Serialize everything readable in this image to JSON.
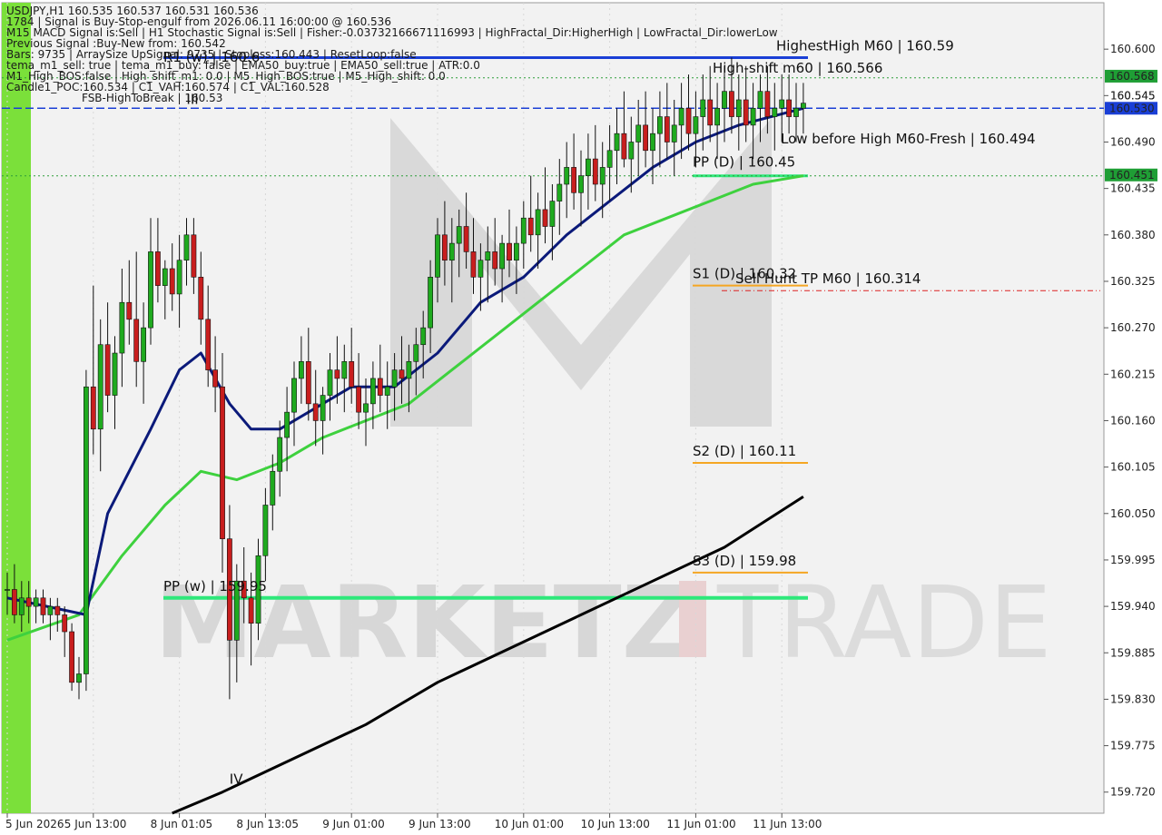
{
  "info": {
    "lines": [
      "USDJPY,H1  160.535 160.537 160.531 160.536",
      "1784 | Signal is Buy-Stop-engulf from 2026.06.11 16:00:00 @ 160.536",
      "M15 MACD Signal is:Sell | H1 Stochastic Signal is:Sell | Fisher:-0.03732166671116993 | HighFractal_Dir:HigherHigh | LowFractal_Dir:lowerLow",
      "Previous Signal :Buy-New from: 160.542",
      "Bars: 9735 | ArraySize UpSignal: 9735 | Stoploss:160.443 | ResetLoop:false",
      "tema_m1_sell: true | tema_m1_buy: false | EMA50_buy:true | EMA50_sell:true | ATR:0.0",
      "M1_High_BOS:false | High_shift_m1: 0.0 | M5_High_BOS:true | M5_High_shift: 0.0",
      "Candle1_POC:160.534 | C1_VAH:160.574 | C1_VAL:160.528",
      "FSB-HighToBreak | 160.53"
    ]
  },
  "colors": {
    "bull": "#1faa1f",
    "bear": "#c81e1e",
    "ema_fast": "#0b1a7a",
    "ema_mid": "#3ed13e",
    "ema_slow": "#000000",
    "pp_line": "#2ee87a",
    "support": "#f5a623",
    "current": "#1a3fd6",
    "tag_green": "#1f9e35",
    "sideband": "#7be03a"
  },
  "chart_data": {
    "type": "candlestick",
    "symbol": "USDJPY",
    "timeframe": "H1",
    "y_axis": {
      "min": 159.695,
      "max": 160.655,
      "ticks": [
        "160.600",
        "160.545",
        "160.490",
        "160.435",
        "160.380",
        "160.325",
        "160.270",
        "160.215",
        "160.160",
        "160.105",
        "160.050",
        "159.995",
        "159.940",
        "159.885",
        "159.830",
        "159.775",
        "159.720"
      ]
    },
    "x_axis": {
      "labels": [
        "5 Jun 2026",
        "5 Jun 13:00",
        "8 Jun 01:05",
        "8 Jun 13:05",
        "9 Jun 01:00",
        "9 Jun 13:00",
        "10 Jun 01:00",
        "10 Jun 13:00",
        "11 Jun 01:00",
        "11 Jun 13:00"
      ],
      "label_bar_index": [
        0,
        12,
        24,
        36,
        48,
        60,
        72,
        84,
        96,
        108
      ]
    },
    "price_tags": [
      {
        "value": 160.568,
        "label": "160.568",
        "kind": "green"
      },
      {
        "value": 160.545,
        "label": "160.545",
        "kind": "plain"
      },
      {
        "value": 160.53,
        "label": "160.530",
        "kind": "blue"
      },
      {
        "value": 160.451,
        "label": "160.451",
        "kind": "green"
      }
    ],
    "levels": [
      {
        "label": "HighestHigh   M60 | 160.59",
        "value": 160.59,
        "kind": "blue"
      },
      {
        "label": "High-shift m60 | 160.566",
        "value": 160.566,
        "kind": "dotted_green"
      },
      {
        "label": "Low before High   M60-Fresh | 160.494",
        "value": 160.494,
        "kind": "none"
      },
      {
        "label": "PP (D) | 160.45",
        "value": 160.45,
        "kind": "pp_short"
      },
      {
        "label": "S1 (D) | 160.32",
        "value": 160.32,
        "kind": "support"
      },
      {
        "label": "Sell Hunt TP M60 | 160.314",
        "value": 160.314,
        "kind": "red_dash"
      },
      {
        "label": "S2 (D) | 160.11",
        "value": 160.11,
        "kind": "support"
      },
      {
        "label": "S3 (D) | 159.98",
        "value": 159.98,
        "kind": "support"
      },
      {
        "label": "PP (w) | 159.95",
        "value": 159.95,
        "kind": "pp_long"
      },
      {
        "label": "R1 (w) | 160.6",
        "value": 160.6,
        "kind": "r1w"
      }
    ],
    "wave_labels": [
      {
        "label": "III",
        "bar": 26,
        "value": 160.535
      },
      {
        "label": "IV",
        "bar": 32,
        "value": 159.73
      }
    ],
    "candles": [
      [
        159.96,
        159.98,
        159.93,
        159.96
      ],
      [
        159.96,
        159.99,
        159.92,
        159.93
      ],
      [
        159.93,
        159.97,
        159.91,
        159.95
      ],
      [
        159.95,
        159.97,
        159.92,
        159.94
      ],
      [
        159.94,
        159.96,
        159.92,
        159.95
      ],
      [
        159.95,
        159.96,
        159.92,
        159.93
      ],
      [
        159.93,
        159.95,
        159.9,
        159.94
      ],
      [
        159.94,
        159.95,
        159.91,
        159.93
      ],
      [
        159.93,
        159.94,
        159.88,
        159.91
      ],
      [
        159.91,
        159.92,
        159.84,
        159.85
      ],
      [
        159.85,
        159.88,
        159.83,
        159.86
      ],
      [
        159.86,
        160.22,
        159.84,
        160.2
      ],
      [
        160.2,
        160.32,
        160.12,
        160.15
      ],
      [
        160.15,
        160.28,
        160.1,
        160.25
      ],
      [
        160.25,
        160.3,
        160.17,
        160.19
      ],
      [
        160.19,
        160.26,
        160.15,
        160.24
      ],
      [
        160.24,
        160.34,
        160.2,
        160.3
      ],
      [
        160.3,
        160.35,
        160.25,
        160.28
      ],
      [
        160.28,
        160.36,
        160.2,
        160.23
      ],
      [
        160.23,
        160.3,
        160.18,
        160.27
      ],
      [
        160.27,
        160.4,
        160.25,
        160.36
      ],
      [
        160.36,
        160.4,
        160.3,
        160.32
      ],
      [
        160.32,
        160.35,
        160.28,
        160.34
      ],
      [
        160.34,
        160.37,
        160.29,
        160.31
      ],
      [
        160.31,
        160.38,
        160.27,
        160.35
      ],
      [
        160.35,
        160.4,
        160.32,
        160.38
      ],
      [
        160.38,
        160.4,
        160.31,
        160.33
      ],
      [
        160.33,
        160.36,
        160.25,
        160.28
      ],
      [
        160.28,
        160.32,
        160.2,
        160.22
      ],
      [
        160.22,
        160.26,
        160.17,
        160.2
      ],
      [
        160.2,
        160.24,
        159.98,
        160.02
      ],
      [
        160.02,
        160.06,
        159.83,
        159.9
      ],
      [
        159.9,
        159.99,
        159.85,
        159.97
      ],
      [
        159.97,
        160.01,
        159.92,
        159.95
      ],
      [
        159.95,
        159.98,
        159.87,
        159.92
      ],
      [
        159.92,
        160.02,
        159.9,
        160.0
      ],
      [
        160.0,
        160.08,
        159.97,
        160.06
      ],
      [
        160.06,
        160.12,
        160.03,
        160.1
      ],
      [
        160.1,
        160.16,
        160.07,
        160.14
      ],
      [
        160.14,
        160.2,
        160.1,
        160.17
      ],
      [
        160.17,
        160.23,
        160.13,
        160.21
      ],
      [
        160.21,
        160.26,
        160.18,
        160.23
      ],
      [
        160.23,
        160.27,
        160.16,
        160.18
      ],
      [
        160.18,
        160.22,
        160.13,
        160.16
      ],
      [
        160.16,
        160.2,
        160.12,
        160.19
      ],
      [
        160.19,
        160.24,
        160.16,
        160.22
      ],
      [
        160.22,
        160.26,
        160.18,
        160.21
      ],
      [
        160.21,
        160.25,
        160.17,
        160.23
      ],
      [
        160.23,
        160.27,
        160.18,
        160.2
      ],
      [
        160.2,
        160.24,
        160.15,
        160.17
      ],
      [
        160.17,
        160.21,
        160.13,
        160.18
      ],
      [
        160.18,
        160.23,
        160.15,
        160.21
      ],
      [
        160.21,
        160.25,
        160.17,
        160.19
      ],
      [
        160.19,
        160.23,
        160.15,
        160.2
      ],
      [
        160.2,
        160.24,
        160.16,
        160.22
      ],
      [
        160.22,
        160.26,
        160.18,
        160.21
      ],
      [
        160.21,
        160.25,
        160.17,
        160.23
      ],
      [
        160.23,
        160.27,
        160.19,
        160.25
      ],
      [
        160.25,
        160.29,
        160.21,
        160.27
      ],
      [
        160.27,
        160.35,
        160.24,
        160.33
      ],
      [
        160.33,
        160.4,
        160.3,
        160.38
      ],
      [
        160.38,
        160.42,
        160.32,
        160.35
      ],
      [
        160.35,
        160.4,
        160.3,
        160.37
      ],
      [
        160.37,
        160.41,
        160.33,
        160.39
      ],
      [
        160.39,
        160.43,
        160.34,
        160.36
      ],
      [
        160.36,
        160.4,
        160.31,
        160.33
      ],
      [
        160.33,
        160.37,
        160.29,
        160.35
      ],
      [
        160.35,
        160.39,
        160.3,
        160.36
      ],
      [
        160.36,
        160.4,
        160.32,
        160.34
      ],
      [
        160.34,
        160.38,
        160.3,
        160.37
      ],
      [
        160.37,
        160.41,
        160.33,
        160.35
      ],
      [
        160.35,
        160.39,
        160.31,
        160.37
      ],
      [
        160.37,
        160.42,
        160.34,
        160.4
      ],
      [
        160.4,
        160.45,
        160.36,
        160.38
      ],
      [
        160.38,
        160.43,
        160.34,
        160.41
      ],
      [
        160.41,
        160.46,
        160.37,
        160.39
      ],
      [
        160.39,
        160.44,
        160.35,
        160.42
      ],
      [
        160.42,
        160.47,
        160.38,
        160.44
      ],
      [
        160.44,
        160.49,
        160.4,
        160.46
      ],
      [
        160.46,
        160.5,
        160.41,
        160.43
      ],
      [
        160.43,
        160.48,
        160.39,
        160.45
      ],
      [
        160.45,
        160.5,
        160.41,
        160.47
      ],
      [
        160.47,
        160.51,
        160.42,
        160.44
      ],
      [
        160.44,
        160.49,
        160.4,
        160.46
      ],
      [
        160.46,
        160.51,
        160.42,
        160.48
      ],
      [
        160.48,
        160.53,
        160.44,
        160.5
      ],
      [
        160.5,
        160.55,
        160.46,
        160.47
      ],
      [
        160.47,
        160.52,
        160.43,
        160.49
      ],
      [
        160.49,
        160.54,
        160.45,
        160.51
      ],
      [
        160.51,
        160.55,
        160.46,
        160.48
      ],
      [
        160.48,
        160.53,
        160.44,
        160.5
      ],
      [
        160.5,
        160.55,
        160.46,
        160.52
      ],
      [
        160.52,
        160.56,
        160.47,
        160.49
      ],
      [
        160.49,
        160.54,
        160.45,
        160.51
      ],
      [
        160.51,
        160.56,
        160.47,
        160.53
      ],
      [
        160.53,
        160.57,
        160.48,
        160.5
      ],
      [
        160.5,
        160.55,
        160.46,
        160.52
      ],
      [
        160.52,
        160.57,
        160.48,
        160.54
      ],
      [
        160.54,
        160.58,
        160.49,
        160.51
      ],
      [
        160.51,
        160.56,
        160.47,
        160.53
      ],
      [
        160.53,
        160.58,
        160.49,
        160.55
      ],
      [
        160.55,
        160.59,
        160.5,
        160.52
      ],
      [
        160.52,
        160.57,
        160.48,
        160.54
      ],
      [
        160.54,
        160.58,
        160.49,
        160.51
      ],
      [
        160.51,
        160.56,
        160.47,
        160.53
      ],
      [
        160.53,
        160.57,
        160.49,
        160.55
      ],
      [
        160.55,
        160.58,
        160.5,
        160.52
      ],
      [
        160.52,
        160.56,
        160.48,
        160.53
      ],
      [
        160.53,
        160.57,
        160.49,
        160.54
      ],
      [
        160.54,
        160.57,
        160.5,
        160.52
      ],
      [
        160.52,
        160.56,
        160.49,
        160.53
      ],
      [
        160.53,
        160.56,
        160.5,
        160.536
      ]
    ],
    "ema_fast": [
      [
        0,
        159.95
      ],
      [
        11,
        159.93
      ],
      [
        14,
        160.05
      ],
      [
        20,
        160.15
      ],
      [
        24,
        160.22
      ],
      [
        27,
        160.24
      ],
      [
        31,
        160.18
      ],
      [
        34,
        160.15
      ],
      [
        38,
        160.15
      ],
      [
        44,
        160.18
      ],
      [
        48,
        160.2
      ],
      [
        54,
        160.2
      ],
      [
        60,
        160.24
      ],
      [
        66,
        160.3
      ],
      [
        72,
        160.33
      ],
      [
        78,
        160.38
      ],
      [
        84,
        160.42
      ],
      [
        90,
        160.46
      ],
      [
        96,
        160.49
      ],
      [
        102,
        160.51
      ],
      [
        111,
        160.53
      ]
    ],
    "ema_mid": [
      [
        0,
        159.9
      ],
      [
        10,
        159.93
      ],
      [
        16,
        160.0
      ],
      [
        22,
        160.06
      ],
      [
        27,
        160.1
      ],
      [
        32,
        160.09
      ],
      [
        38,
        160.11
      ],
      [
        44,
        160.14
      ],
      [
        50,
        160.16
      ],
      [
        56,
        160.18
      ],
      [
        62,
        160.22
      ],
      [
        68,
        160.26
      ],
      [
        74,
        160.3
      ],
      [
        80,
        160.34
      ],
      [
        86,
        160.38
      ],
      [
        92,
        160.4
      ],
      [
        98,
        160.42
      ],
      [
        104,
        160.44
      ],
      [
        111,
        160.45
      ]
    ],
    "ema_slow": [
      [
        23,
        159.695
      ],
      [
        30,
        159.72
      ],
      [
        40,
        159.76
      ],
      [
        50,
        159.8
      ],
      [
        60,
        159.85
      ],
      [
        70,
        159.89
      ],
      [
        80,
        159.93
      ],
      [
        90,
        159.97
      ],
      [
        100,
        160.01
      ],
      [
        111,
        160.07
      ]
    ]
  }
}
